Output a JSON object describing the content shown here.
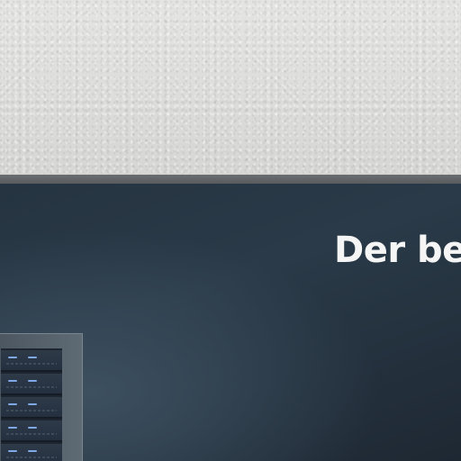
{
  "billboard": {
    "headline": "Der be"
  },
  "illustration": {
    "icon": "server-rack-icon"
  },
  "colors": {
    "board": "#263441",
    "frame": "#6b6e70",
    "wall": "#dcdcda",
    "headline": "#f5f5f5",
    "led": "#7fa8e6"
  }
}
